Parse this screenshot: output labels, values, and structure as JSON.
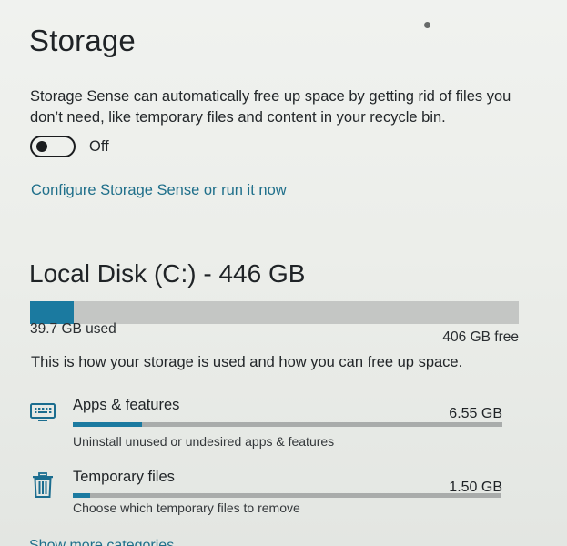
{
  "header": {
    "title": "Storage"
  },
  "storage_sense": {
    "description": "Storage Sense can automatically free up space by getting rid of files you don’t need, like temporary files and content in your recycle bin.",
    "toggle_state": "Off",
    "toggle_on": false,
    "configure_link": "Configure Storage Sense or run it now"
  },
  "disk": {
    "title": "Local Disk (C:) - 446 GB",
    "used_label": "39.7 GB used",
    "free_label": "406 GB free",
    "used_fraction": 0.089,
    "explainer": "This is how your storage is used and how you can free up space."
  },
  "categories": [
    {
      "name": "Apps & features",
      "size": "6.55 GB",
      "description": "Uninstall unused or undesired apps & features",
      "icon": "keyboard-icon",
      "fill_fraction": 0.16
    },
    {
      "name": "Temporary files",
      "size": "1.50 GB",
      "description": "Choose which temporary files to remove",
      "icon": "trash-icon",
      "fill_fraction": 0.04
    }
  ],
  "footer": {
    "show_more_label": "Show more categories"
  },
  "colors": {
    "accent": "#1b7aa0",
    "link": "#1f6f8a",
    "bar_track": "#c4c6c4"
  }
}
